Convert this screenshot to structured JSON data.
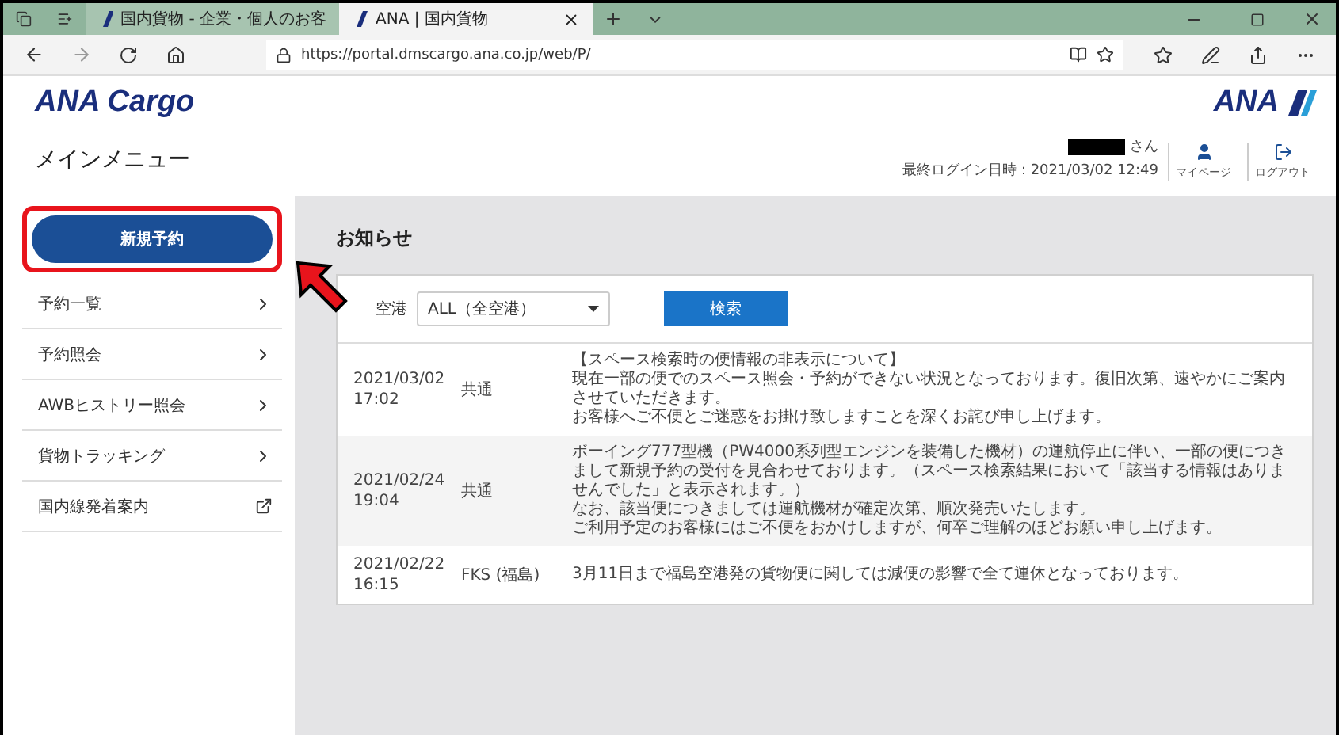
{
  "browser": {
    "tabs": [
      {
        "title": "国内貨物 - 企業・個人のお客",
        "selected": false
      },
      {
        "title": "ANA | 国内貨物",
        "selected": true
      }
    ],
    "url": "https://portal.dmscargo.ana.co.jp/web/P/"
  },
  "header": {
    "logo": "ANA Cargo",
    "brand": "ANA",
    "page_title": "メインメニュー",
    "user_suffix": "さん",
    "last_login": "最終ログイン日時：2021/03/02 12:49",
    "actions": [
      {
        "label": "マイページ",
        "kind": "user"
      },
      {
        "label": "ログアウト",
        "kind": "logout"
      }
    ]
  },
  "sidebar": {
    "primary_button": "新規予約",
    "highlighted": true,
    "items": [
      {
        "label": "予約一覧",
        "kind": "chevron"
      },
      {
        "label": "予約照会",
        "kind": "chevron"
      },
      {
        "label": "AWBヒストリー照会",
        "kind": "chevron"
      },
      {
        "label": "貨物トラッキング",
        "kind": "chevron"
      },
      {
        "label": "国内線発着案内",
        "kind": "external"
      }
    ]
  },
  "notices": {
    "title": "お知らせ",
    "filter_label": "空港",
    "filter_value": "ALL（全空港）",
    "search_button": "検索",
    "rows": [
      {
        "date": "2021/03/02",
        "time": "17:02",
        "category": "共通",
        "lines": [
          "【スペース検索時の便情報の非表示について】",
          "現在一部の便でのスペース照会・予約ができない状況となっております。復旧次第、速やかにご案内させていただきます。",
          "お客様へご不便とご迷惑をお掛け致しますことを深くお詫び申し上げます。"
        ]
      },
      {
        "date": "2021/02/24",
        "time": "19:04",
        "category": "共通",
        "lines": [
          "ボーイング777型機（PW4000系列型エンジンを装備した機材）の運航停止に伴い、一部の便につきまして新規予約の受付を見合わせております。（スペース検索結果において「該当する情報はありませんでした」と表示されます。）",
          "なお、該当便につきましては運航機材が確定次第、順次発売いたします。",
          "ご利用予定のお客様にはご不便をおかけしますが、何卒ご理解のほどお願い申し上げます。"
        ]
      },
      {
        "date": "2021/02/22",
        "time": "16:15",
        "category": "FKS (福島)",
        "lines": [
          "3月11日まで福島空港発の貨物便に関しては減便の影響で全て運休となっております。"
        ]
      }
    ]
  }
}
